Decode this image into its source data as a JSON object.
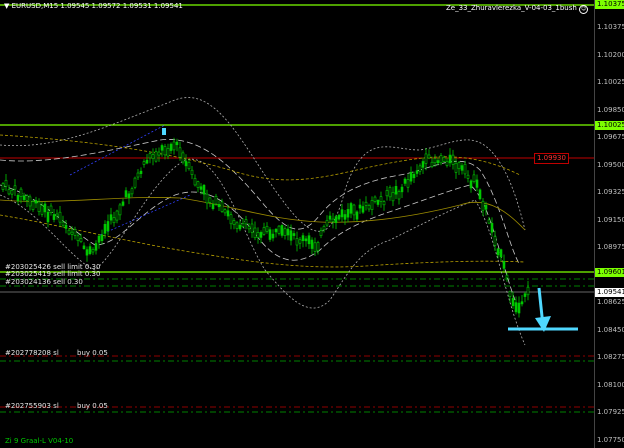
{
  "chart_header": {
    "symbol_line": "EURUSD,M15  1.09545 1.09572 1.09531 1.09541",
    "indicator_name": "Ze_33_Zhuravlerezka_V-04-03_1bush"
  },
  "footer": {
    "label": "Zi 9 Graal-L V04-10"
  },
  "colors": {
    "background": "#000000",
    "candle": "#00c800",
    "green_level": "#7cff00",
    "red_level": "#c00000",
    "arrow": "#4fd8ff",
    "band_dash": "#b0b0b0",
    "band_yellow": "#b8a000"
  },
  "price_scale": {
    "ticks": [
      "1.10375",
      "1.10200",
      "1.10025",
      "1.09850",
      "1.09675",
      "1.09500",
      "1.09325",
      "1.09150",
      "1.08975",
      "1.08800",
      "1.08625",
      "1.08450",
      "1.08275",
      "1.08100",
      "1.07925",
      "1.07750"
    ]
  },
  "level_flags": {
    "top_green": "1.10375",
    "upper_green": "1.10025",
    "red_line": "1.09930",
    "lower_green": "1.09601",
    "bid": "1.09541"
  },
  "orders": {
    "sell_limit_1": "#203025426 sell limit 0.30",
    "sell_limit_2": "#203025419 sell limit 0.30",
    "sell": "#203024136 sell 0.30",
    "buy_1": "#202778208 sl",
    "buy_1_tail": "buy 0.05",
    "buy_2": "#202755903 sl",
    "buy_2_tail": "buy 0.05"
  },
  "indicator_icon": "smiley-icon",
  "direction_arrow": "down-arrow-icon"
}
